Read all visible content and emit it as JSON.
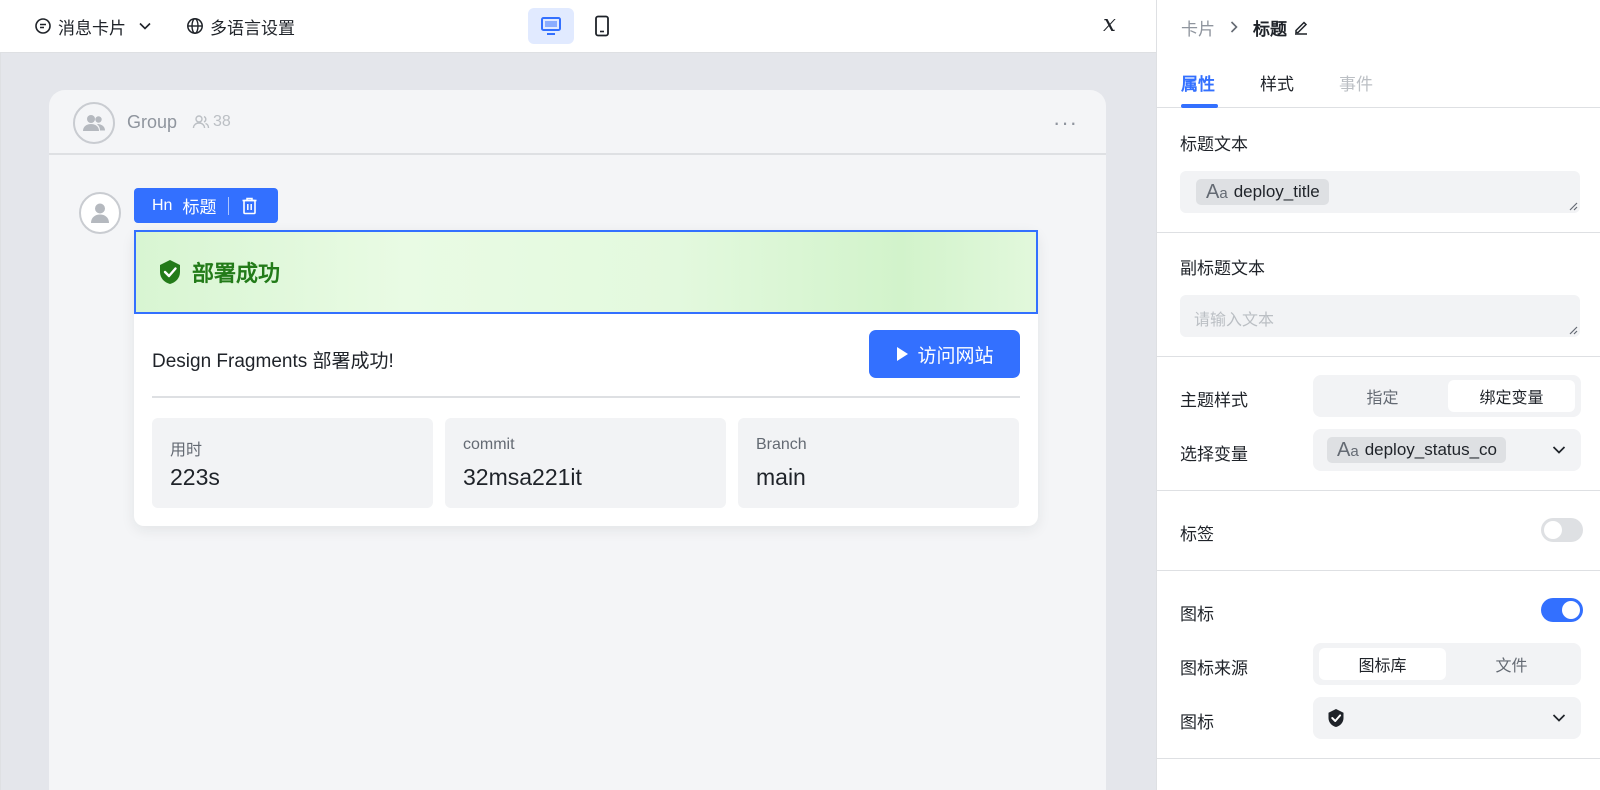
{
  "topbar": {
    "message_card_label": "消息卡片",
    "language_settings_label": "多语言设置",
    "variable_icon_glyph": "𝑥"
  },
  "chat": {
    "group_name": "Group",
    "member_count": "38",
    "more_glyph": "···"
  },
  "selection_toolbar": {
    "type_glyph": "Hn",
    "label": "标题"
  },
  "card": {
    "header_title": "部署成功",
    "body_text": "Design Fragments 部署成功!",
    "visit_button_label": "访问网站",
    "stats": [
      {
        "label": "用时",
        "value": "223s"
      },
      {
        "label": "commit",
        "value": "32msa221it"
      },
      {
        "label": "Branch",
        "value": "main"
      }
    ],
    "header_color": "#237b19"
  },
  "panel": {
    "breadcrumb": {
      "parent": "卡片",
      "current": "标题"
    },
    "tabs": [
      {
        "label": "属性",
        "state": "active"
      },
      {
        "label": "样式",
        "state": "normal"
      },
      {
        "label": "事件",
        "state": "disabled"
      }
    ],
    "title_text": {
      "label": "标题文本",
      "variable": "deploy_title"
    },
    "subtitle_text": {
      "label": "副标题文本",
      "placeholder": "请输入文本"
    },
    "theme_style": {
      "label": "主题样式",
      "options": [
        "指定",
        "绑定变量"
      ],
      "selected": "绑定变量"
    },
    "select_variable": {
      "label": "选择变量",
      "value": "deploy_status_co"
    },
    "tag": {
      "label": "标签",
      "enabled": false
    },
    "icon": {
      "label": "图标",
      "enabled": true
    },
    "icon_source": {
      "label": "图标来源",
      "options": [
        "图标库",
        "文件"
      ],
      "selected": "图标库"
    },
    "icon_select": {
      "label": "图标",
      "value_icon": "shield-check-icon"
    },
    "accent_color": "#3370ff"
  }
}
